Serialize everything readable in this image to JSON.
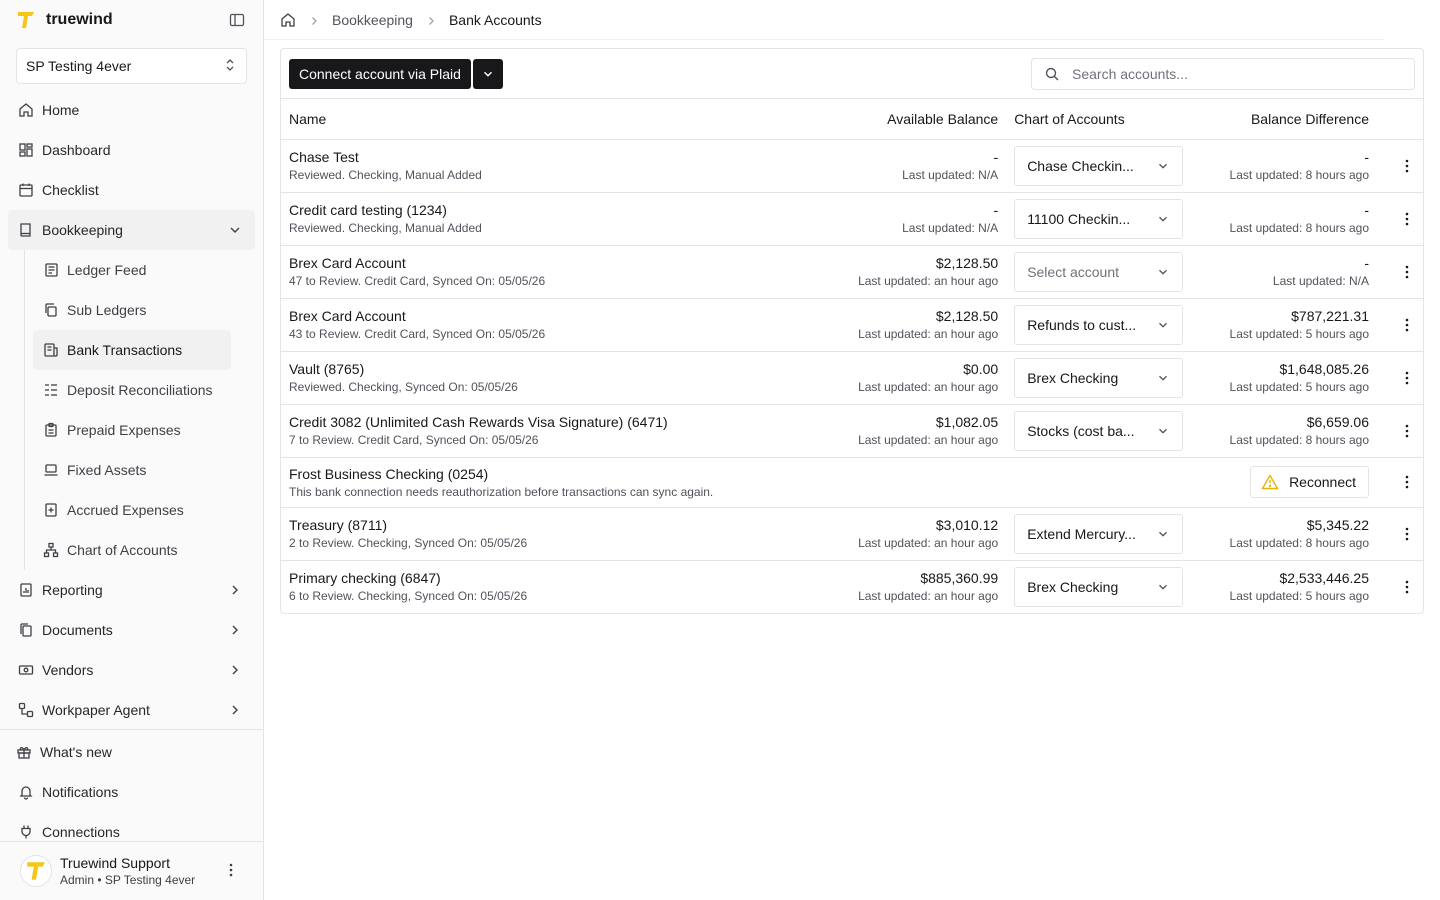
{
  "app": {
    "name": "truewind"
  },
  "org": {
    "selected": "SP Testing 4ever"
  },
  "nav": {
    "home": "Home",
    "dashboard": "Dashboard",
    "checklist": "Checklist",
    "bookkeeping": "Bookkeeping",
    "sub": {
      "ledger_feed": "Ledger Feed",
      "sub_ledgers": "Sub Ledgers",
      "bank_transactions": "Bank Transactions",
      "deposit_reconciliations": "Deposit Reconciliations",
      "prepaid_expenses": "Prepaid Expenses",
      "fixed_assets": "Fixed Assets",
      "accrued_expenses": "Accrued Expenses",
      "chart_of_accounts": "Chart of Accounts"
    },
    "reporting": "Reporting",
    "documents": "Documents",
    "vendors": "Vendors",
    "workpaper_agent": "Workpaper Agent",
    "whats_new": "What's new",
    "notifications": "Notifications",
    "connections": "Connections"
  },
  "user": {
    "name": "Truewind Support",
    "role": "Admin • SP Testing 4ever"
  },
  "breadcrumb": {
    "parent": "Bookkeeping",
    "current": "Bank Accounts"
  },
  "toolbar": {
    "connect_label": "Connect account via Plaid",
    "search_placeholder": "Search accounts..."
  },
  "table": {
    "headers": {
      "name": "Name",
      "available_balance": "Available Balance",
      "chart_of_accounts": "Chart of Accounts",
      "balance_difference": "Balance Difference"
    },
    "rows": [
      {
        "name": "Chase Test",
        "sub": "Reviewed. Checking, Manual Added",
        "balance": "-",
        "balance_updated": "Last updated: N/A",
        "coa": "Chase Checkin...",
        "diff": "-",
        "diff_updated": "Last updated: 8 hours ago"
      },
      {
        "name": "Credit card testing (1234)",
        "sub": "Reviewed. Checking, Manual Added",
        "balance": "-",
        "balance_updated": "Last updated: N/A",
        "coa": "11100 Checkin...",
        "diff": "-",
        "diff_updated": "Last updated: 8 hours ago"
      },
      {
        "name": "Brex Card Account",
        "sub": "47 to Review. Credit Card, Synced On: 05/05/26",
        "balance": "$2,128.50",
        "balance_updated": "Last updated: an hour ago",
        "coa": "Select account",
        "diff": "-",
        "diff_updated": "Last updated: N/A"
      },
      {
        "name": "Brex Card Account",
        "sub": "43 to Review. Credit Card, Synced On: 05/05/26",
        "balance": "$2,128.50",
        "balance_updated": "Last updated: an hour ago",
        "coa": "Refunds to cust...",
        "diff": "$787,221.31",
        "diff_updated": "Last updated: 5 hours ago"
      },
      {
        "name": "Vault (8765)",
        "sub": "Reviewed. Checking, Synced On: 05/05/26",
        "balance": "$0.00",
        "balance_updated": "Last updated: an hour ago",
        "coa": "Brex Checking",
        "diff": "$1,648,085.26",
        "diff_updated": "Last updated: 5 hours ago"
      },
      {
        "name": "Credit 3082 (Unlimited Cash Rewards Visa Signature) (6471)",
        "sub": "7 to Review. Credit Card, Synced On: 05/05/26",
        "balance": "$1,082.05",
        "balance_updated": "Last updated: an hour ago",
        "coa": "Stocks (cost ba...",
        "diff": "$6,659.06",
        "diff_updated": "Last updated: 8 hours ago"
      },
      {
        "name": "Frost Business Checking (0254)",
        "sub": "This bank connection needs reauthorization before transactions can sync again.",
        "reconnect": "Reconnect"
      },
      {
        "name": "Treasury (8711)",
        "sub": "2 to Review. Checking, Synced On: 05/05/26",
        "balance": "$3,010.12",
        "balance_updated": "Last updated: an hour ago",
        "coa": "Extend Mercury...",
        "diff": "$5,345.22",
        "diff_updated": "Last updated: 8 hours ago"
      },
      {
        "name": "Primary checking (6847)",
        "sub": "6 to Review. Checking, Synced On: 05/05/26",
        "balance": "$885,360.99",
        "balance_updated": "Last updated: an hour ago",
        "coa": "Brex Checking",
        "diff": "$2,533,446.25",
        "diff_updated": "Last updated: 5 hours ago"
      }
    ]
  },
  "colors": {
    "brand": "#f5c518",
    "dark_button": "#18181b",
    "warning": "#eab308"
  }
}
